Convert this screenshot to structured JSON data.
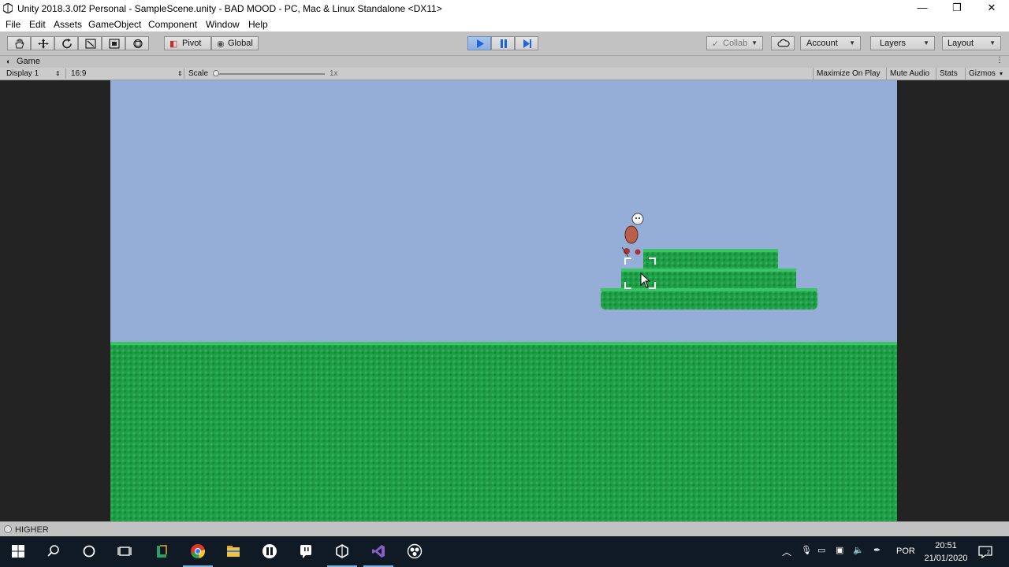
{
  "window": {
    "title": "Unity 2018.3.0f2 Personal - SampleScene.unity - BAD MOOD - PC, Mac & Linux Standalone <DX11>"
  },
  "menu": [
    "File",
    "Edit",
    "Assets",
    "GameObject",
    "Component",
    "Window",
    "Help"
  ],
  "toolbar": {
    "pivot": "Pivot",
    "global": "Global",
    "collab": "Collab",
    "account": "Account",
    "layers": "Layers",
    "layout": "Layout"
  },
  "game_tab": {
    "label": "Game",
    "display": "Display 1",
    "aspect": "16:9",
    "scale_label": "Scale",
    "scale_value": "1x",
    "maximize": "Maximize On Play",
    "mute": "Mute Audio",
    "stats": "Stats",
    "gizmos": "Gizmos"
  },
  "status": {
    "message": "HIGHER"
  },
  "taskbar": {
    "language": "POR",
    "time": "20:51",
    "date": "21/01/2020"
  },
  "colors": {
    "sky": "#95aed8",
    "grass": "#1f9e47",
    "play_active": "#8db0e0"
  },
  "icons": [
    "unity-logo-icon",
    "hand-tool-icon",
    "move-tool-icon",
    "rotate-tool-icon",
    "scale-tool-icon",
    "rect-tool-icon",
    "transform-tool-icon",
    "play-icon",
    "pause-icon",
    "step-icon",
    "cloud-icon",
    "windows-start-icon",
    "search-icon",
    "cortana-icon",
    "task-view-icon",
    "chrome-icon",
    "folder-icon",
    "notification-icon"
  ]
}
